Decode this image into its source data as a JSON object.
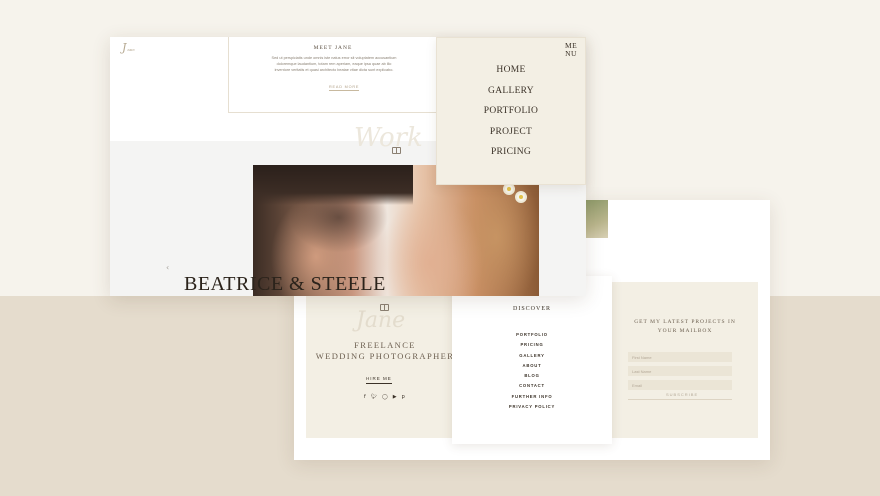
{
  "hero": {
    "about_title": "MEET JANE",
    "about_text": "Sed ut perspiciatis unde omnis iste natus error sit voluptatem accusantium doloremque laudantium, totam rem aperiam, eaque ipsa quae ab illo inventore veritatis et quasi architecto beatae vitae dicta sunt explicabo.",
    "about_link": "READ MORE",
    "work_script": "Work",
    "couple_title": "BEATRICE & STEELE"
  },
  "menu": {
    "close_label": "ME NU",
    "items": [
      "HOME",
      "GALLERY",
      "PORTFOLIO",
      "PROJECT",
      "PRICING"
    ]
  },
  "footer": {
    "brand_script": "Jane",
    "tagline_line1": "FREELANCE",
    "tagline_line2": "WEDDING PHOTOGRAPHER",
    "hire_label": "HIRE ME",
    "socials": [
      "f",
      "t",
      "ig",
      "yt",
      "p"
    ],
    "discover_title": "DISCOVER",
    "discover_items": [
      "PORTFOLIO",
      "PRICING",
      "GALLERY",
      "ABOUT",
      "BLOG",
      "CONTACT",
      "FURTHER INFO",
      "PRIVACY POLICY"
    ],
    "newsletter_title_line1": "GET MY LATEST PROJECTS IN",
    "newsletter_title_line2": "YOUR MAILBOX",
    "newsletter_fields": [
      "First Name",
      "Last Name",
      "Email"
    ],
    "subscribe_label": "SUBSCRIBE"
  },
  "colors": {
    "background": "#f6f3ec",
    "lower_band": "#e5dccd",
    "panel_cream": "#f3efe4",
    "text_dark": "#3b3228"
  }
}
